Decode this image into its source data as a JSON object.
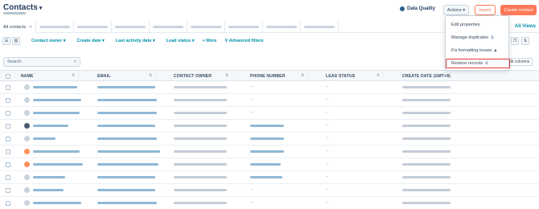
{
  "header": {
    "title": "Contacts",
    "data_quality": "Data Quality",
    "actions_label": "Actions ▾",
    "import_label": "Import",
    "create_label": "Create contact"
  },
  "tabs": {
    "active_label": "All contacts",
    "all_views": "All Views"
  },
  "filters": {
    "contact_owner": "Contact owner ▾",
    "create_date": "Create date ▾",
    "last_activity": "Last activity date ▾",
    "lead_status": "Lead status ▾",
    "more": "+ More",
    "advanced": "Advanced filters"
  },
  "search": {
    "placeholder": "Search"
  },
  "edit_columns": "Edit columns",
  "columns": {
    "name": "NAME",
    "email": "EMAIL",
    "owner": "CONTACT OWNER",
    "phone": "PHONE NUMBER",
    "lead_status": "LEAD STATUS",
    "create_date": "CREATE DATE (GMT+8)"
  },
  "cell_dash": "--",
  "menu": {
    "items": [
      {
        "label": "Edit properties",
        "icon": ""
      },
      {
        "label": "Manage duplicates",
        "icon": "external-link-icon"
      },
      {
        "label": "Fix formatting issues",
        "icon": "lock-icon"
      },
      {
        "label": "Restore records",
        "icon": "external-link-icon"
      }
    ]
  },
  "colors": {
    "accent": "#ff7a59",
    "link": "#0091ae",
    "highlight_border": "#e03a3a"
  }
}
